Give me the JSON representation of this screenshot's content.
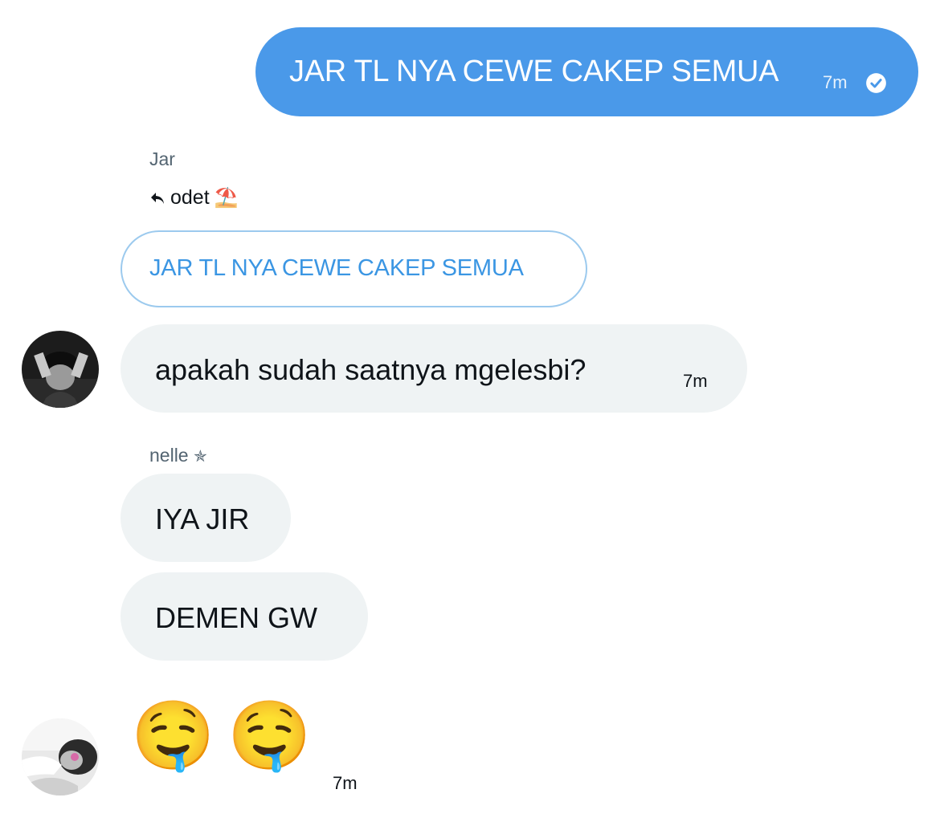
{
  "messages": {
    "sent": {
      "text": "JAR TL NYA CEWE CAKEP SEMUA",
      "time": "7m",
      "status_icon": "check-circle-icon"
    },
    "reply_block": {
      "sender": "Jar",
      "reply_to_name": "odet",
      "reply_to_emoji": "⛱️",
      "quoted_text": "JAR TL NYA CEWE CAKEP SEMUA",
      "message": "apakah sudah saatnya mgelesbi?",
      "time": "7m"
    },
    "nelle_block": {
      "sender": "nelle",
      "sender_badge": "✯",
      "messages": [
        "IYA JIR",
        "DEMEN GW"
      ]
    },
    "emoji_block": {
      "emojis": [
        "🤤",
        "🤤"
      ],
      "time": "7m"
    }
  },
  "colors": {
    "sent_bubble": "#4a99e9",
    "received_bubble": "#eff3f4",
    "quote_border": "#9ccaee",
    "quote_text": "#3b96e3",
    "muted_text": "#536471"
  }
}
